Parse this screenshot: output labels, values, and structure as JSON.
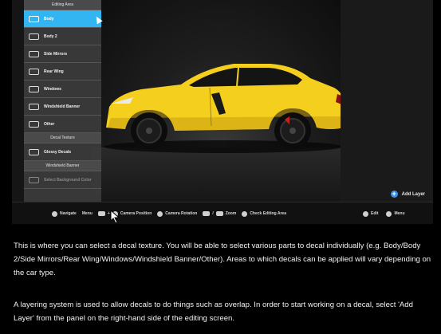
{
  "editing_menu": {
    "title": "Editing Area",
    "items": [
      {
        "label": "Body",
        "icon": "car-body-icon",
        "selected": true
      },
      {
        "label": "Body 2",
        "icon": "body2-icon",
        "selected": false
      },
      {
        "label": "Side Mirrors",
        "icon": "mirror-icon",
        "selected": false
      },
      {
        "label": "Rear Wing",
        "icon": "wing-icon",
        "selected": false
      },
      {
        "label": "Windows",
        "icon": "window-icon",
        "selected": false
      },
      {
        "label": "Windshield Banner",
        "icon": "windshield-icon",
        "selected": false
      },
      {
        "label": "Other",
        "icon": "other-icon",
        "selected": false
      }
    ],
    "decal_texture_header": "Decal Texture",
    "decal_texture_item": "Glossy Decals",
    "windshield_banner_header": "Windshield Banner",
    "windshield_banner_item": "Select Background Color"
  },
  "right_panel": {
    "add_layer_label": "Add Layer",
    "edit_label": "Edit",
    "menu_label": "Menu"
  },
  "bottom_bar": {
    "navigate_label": "Navigate",
    "menu_label": "Menu",
    "camera_position_label": "Camera Position",
    "camera_rotation_label": "Camera Rotation",
    "zoom_label": "Zoom",
    "check_editing_area_label": "Check Editing Area"
  },
  "description": {
    "paragraph1": "This is where you can select a decal texture. You will be able to select various parts to decal individually (e.g. Body/Body 2/Side Mirrors/Rear Wing/Windows/Windshield Banner/Other). Areas to which decals can be applied will vary depending on the car type.",
    "paragraph2": "A layering system is used to allow decals to do things such as overlap. In order to start working on a decal, select 'Add Layer' from the panel on the right-hand side of the editing screen."
  },
  "colors": {
    "accent_selected": "#33b5f2",
    "car_yellow": "#f5cf1e",
    "add_layer_button": "#3a8ee6"
  }
}
